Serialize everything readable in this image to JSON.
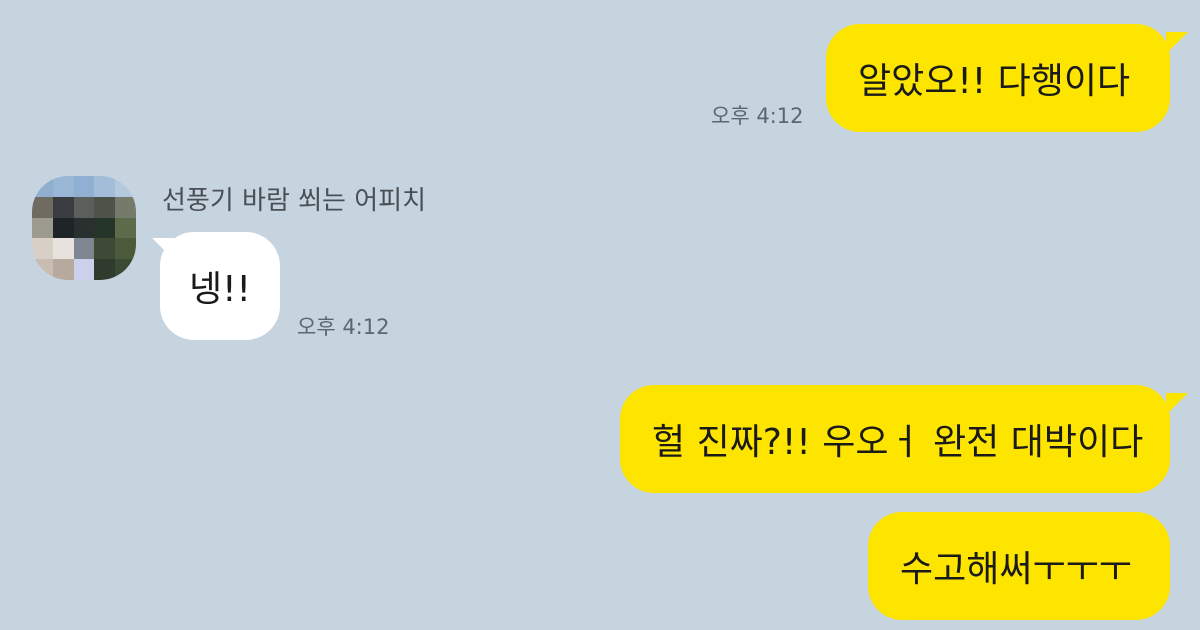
{
  "conversation": {
    "messages": [
      {
        "sender": "me",
        "text": "알았오!! 다행이다",
        "time": "오후 4:12"
      },
      {
        "sender": "other",
        "name": "선풍기 바람 쐬는 어피치",
        "text": "넹!!",
        "time": "오후 4:12"
      },
      {
        "sender": "me",
        "text": "헐 진짜?!! 우오ㅓ 완전 대박이다"
      },
      {
        "sender": "me",
        "text": "수고해써ㅜㅜㅜ"
      }
    ]
  },
  "colors": {
    "background": "#c6d4e0",
    "my_bubble": "#fee500",
    "their_bubble": "#ffffff",
    "timestamp": "#5d6670"
  },
  "icons": {
    "avatar": "pixelated-profile-avatar"
  }
}
